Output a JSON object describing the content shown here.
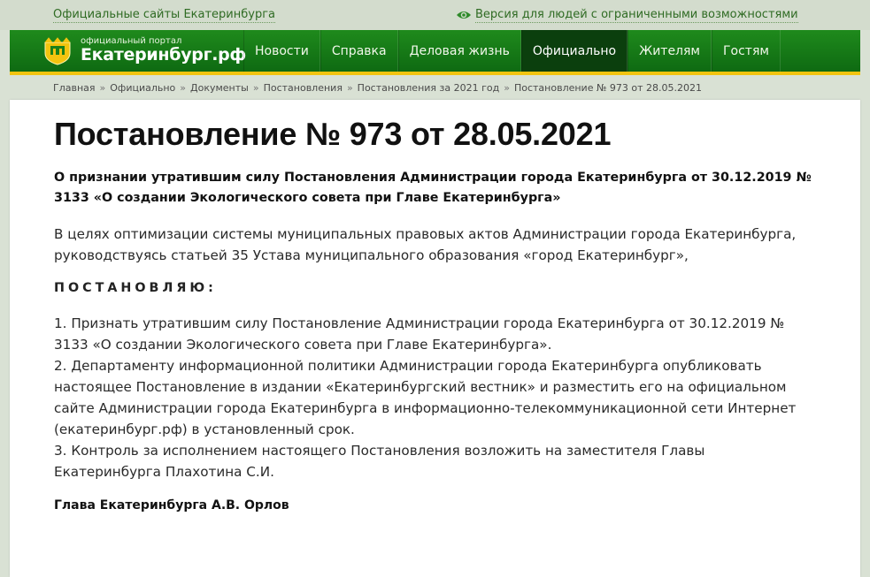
{
  "topbar": {
    "sites_link": "Официальные сайты Екатеринбурга",
    "accessibility_link": "Версия для людей с ограниченными возможностями"
  },
  "logo": {
    "small": "официальный портал",
    "big": "Екатеринбург.рф"
  },
  "nav": {
    "items": [
      {
        "label": "Новости"
      },
      {
        "label": "Справка"
      },
      {
        "label": "Деловая жизнь"
      },
      {
        "label": "Официально"
      },
      {
        "label": "Жителям"
      },
      {
        "label": "Гостям"
      }
    ],
    "active_index": 3
  },
  "breadcrumb": {
    "separator": "»",
    "items": [
      "Главная",
      "Официально",
      "Документы",
      "Постановления",
      "Постановления за 2021 год",
      "Постановление № 973 от 28.05.2021"
    ]
  },
  "document": {
    "title": "Постановление № 973 от 28.05.2021",
    "subtitle": "О признании утратившим силу Постановления Администрации города Екатеринбурга от 30.12.2019 № 3133 «О создании Экологического совета при Главе Екатеринбурга»",
    "preamble": "В целях оптимизации системы муниципальных правовых актов Администрации города Екатеринбурга, руководствуясь статьей 35 Устава муниципального образования «город Екатеринбург»,",
    "decree": "ПОСТАНОВЛЯЮ:",
    "items": [
      "1. Признать утратившим силу Постановление Администрации города Екатеринбурга от 30.12.2019 № 3133 «О создании Экологического совета при Главе Екатеринбурга».",
      "2. Департаменту информационной политики Администрации города Екатеринбурга опубликовать настоящее Постановление в издании «Екатеринбургский вестник» и разместить его на официальном сайте Администрации города Екатеринбурга в информационно-телекоммуникационной сети Интернет (екатеринбург.рф) в установленный срок.",
      "3. Контроль за исполнением настоящего Постановления возложить на заместителя Главы Екатеринбурга Плахотина С.И."
    ],
    "signature": "Глава Екатеринбурга А.В. Орлов"
  },
  "colors": {
    "nav_green": "#1a7f1a",
    "nav_active": "#0b3f0d",
    "accent_yellow": "#f2c40f",
    "link_green": "#2f6b23"
  }
}
